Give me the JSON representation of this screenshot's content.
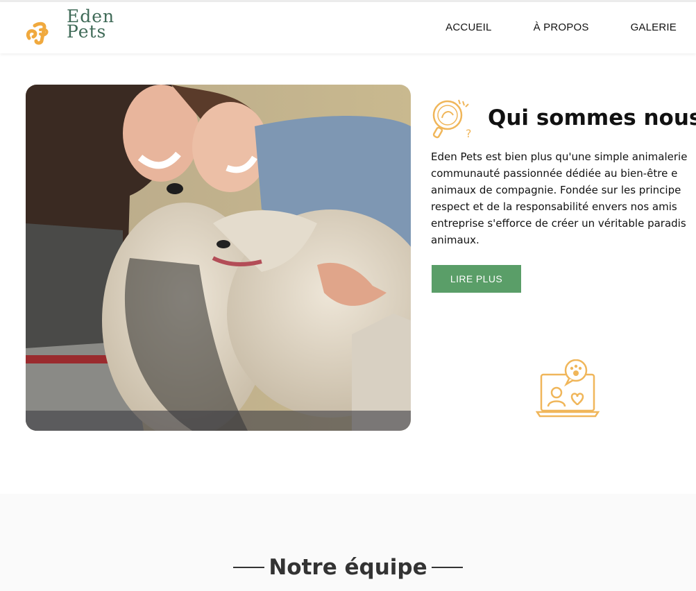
{
  "header": {
    "logo": {
      "line1": "Eden",
      "line2": "Pets",
      "mark_color": "#f0a93e",
      "text_color": "#3f6a57"
    },
    "nav": [
      {
        "label": "ACCUEIL"
      },
      {
        "label": "À PROPOS"
      },
      {
        "label": "GALERIE"
      }
    ]
  },
  "hero": {
    "image_subject": "two laughing women hugging two fluffy dogs"
  },
  "about": {
    "title": "Qui sommes nous",
    "paragraph_lines": [
      "Eden Pets est bien plus qu'une simple animalerie",
      "communauté passionnée dédiée au bien-être e",
      "animaux de compagnie. Fondée sur les principe",
      "respect et de la responsabilité envers nos amis",
      "entreprise s'efforce de créer un véritable paradis",
      "animaux."
    ],
    "button_label": "LIRE PLUS",
    "icon_color": "#f0b65a"
  },
  "team": {
    "title": "Notre équipe"
  },
  "colors": {
    "accent_green": "#5a9e68",
    "accent_orange": "#f0b65a"
  }
}
